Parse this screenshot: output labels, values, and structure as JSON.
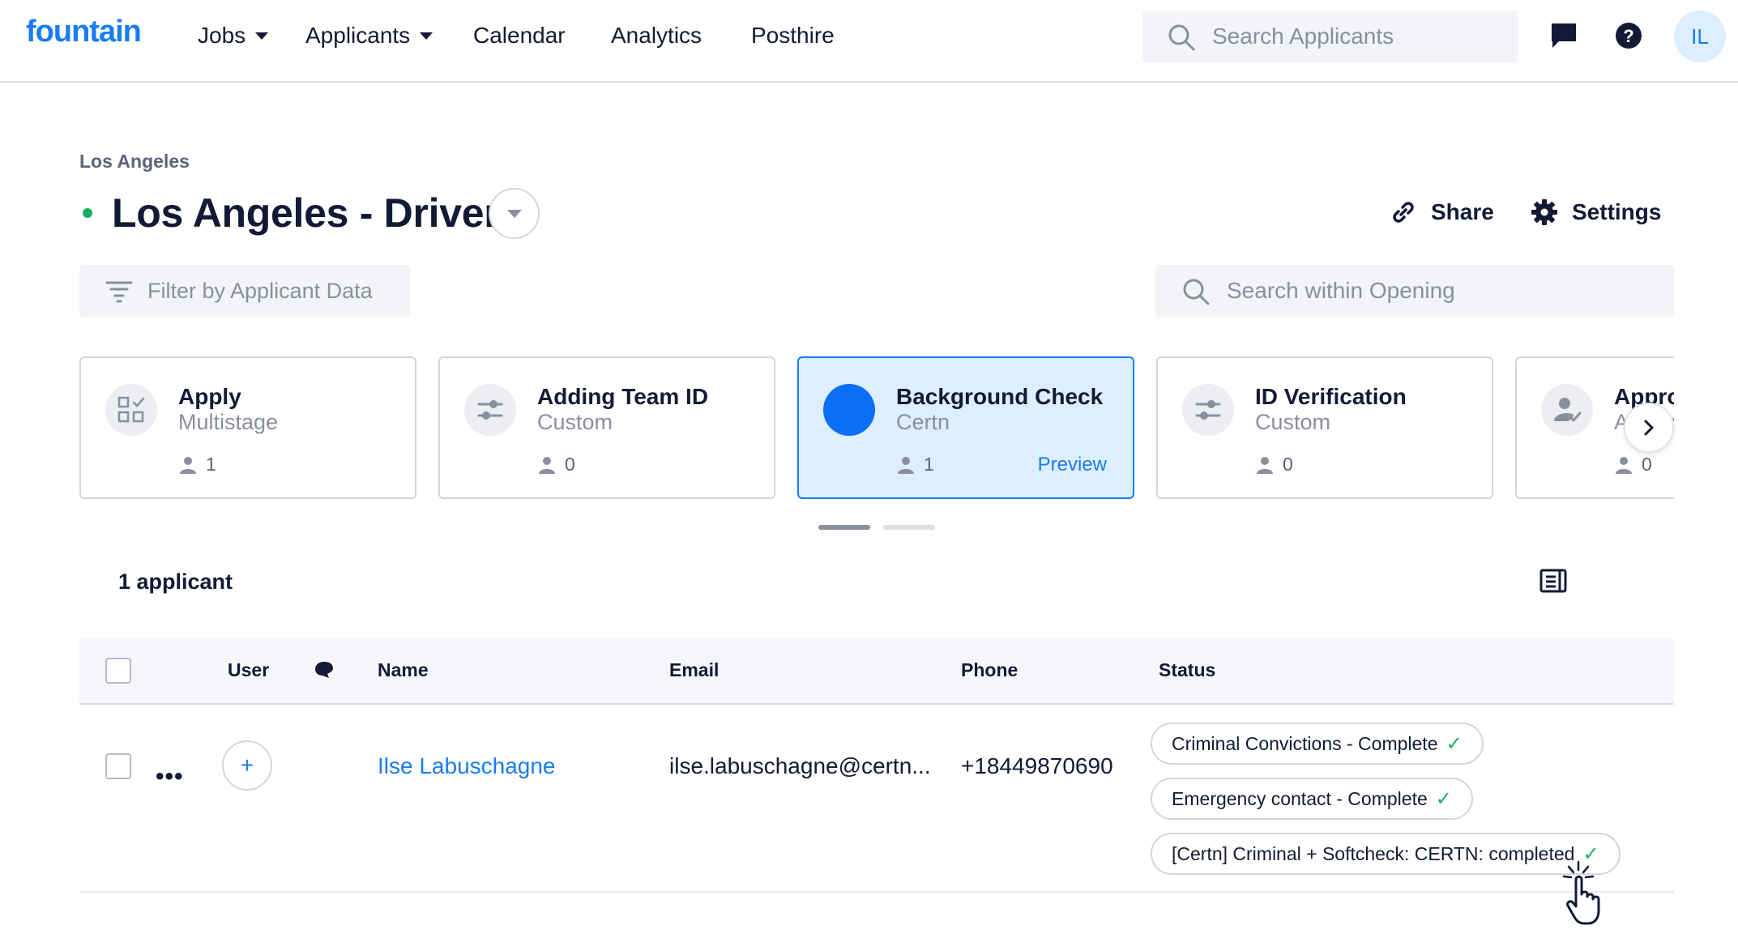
{
  "nav": {
    "logo": "fountain",
    "items": [
      {
        "label": "Jobs",
        "dropdown": true
      },
      {
        "label": "Applicants",
        "dropdown": true
      },
      {
        "label": "Calendar",
        "dropdown": false
      },
      {
        "label": "Analytics",
        "dropdown": false
      },
      {
        "label": "Posthire",
        "dropdown": false
      }
    ],
    "search_placeholder": "Search Applicants",
    "user_initials": "IL"
  },
  "opening": {
    "breadcrumb": "Los Angeles",
    "title": "Los Angeles - Driver",
    "status": "active",
    "share_label": "Share",
    "settings_label": "Settings",
    "filter_label": "Filter by Applicant Data",
    "search_placeholder": "Search within Opening"
  },
  "stages": [
    {
      "name": "Apply",
      "type": "Multistage",
      "count": "1",
      "icon": "checklist-icon",
      "active": false
    },
    {
      "name": "Adding Team ID",
      "type": "Custom",
      "count": "0",
      "icon": "sliders-icon",
      "active": false
    },
    {
      "name": "Background Check",
      "type": "Certn",
      "count": "1",
      "icon": "certn-logo-icon",
      "active": true,
      "preview_label": "Preview"
    },
    {
      "name": "ID Verification",
      "type": "Custom",
      "count": "0",
      "icon": "sliders-icon",
      "active": false
    },
    {
      "name": "Approval",
      "type": "Approval",
      "count": "0",
      "icon": "user-check-icon",
      "active": false
    }
  ],
  "pager": {
    "pages": 2,
    "current": 1
  },
  "applicants": {
    "count_label": "1 applicant",
    "columns": {
      "user": "User",
      "name": "Name",
      "email": "Email",
      "phone": "Phone",
      "status": "Status"
    },
    "rows": [
      {
        "name": "Ilse Labuschagne",
        "email": "ilse.labuschagne@certn...",
        "phone": "+18449870690",
        "statuses": [
          "Criminal Convictions - Complete",
          "Emergency contact - Complete",
          "[Certn] Criminal + Softcheck: CERTN: completed"
        ]
      }
    ]
  },
  "colors": {
    "brand": "#1a7cf2",
    "active_stage_bg": "#ddeefe",
    "success": "#16b05c",
    "text": "#131a35"
  }
}
